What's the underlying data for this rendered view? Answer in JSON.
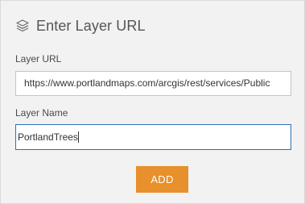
{
  "dialog": {
    "title": "Enter Layer URL",
    "title_icon": "layers-icon"
  },
  "layer_url": {
    "label": "Layer URL",
    "value": "https://www.portlandmaps.com/arcgis/rest/services/Public"
  },
  "layer_name": {
    "label": "Layer Name",
    "value": "PortlandTrees"
  },
  "actions": {
    "add_label": "ADD",
    "add_color": "#e8902b"
  },
  "colors": {
    "panel_background": "#f2f2f2",
    "focus_border": "#2e6fb7"
  }
}
